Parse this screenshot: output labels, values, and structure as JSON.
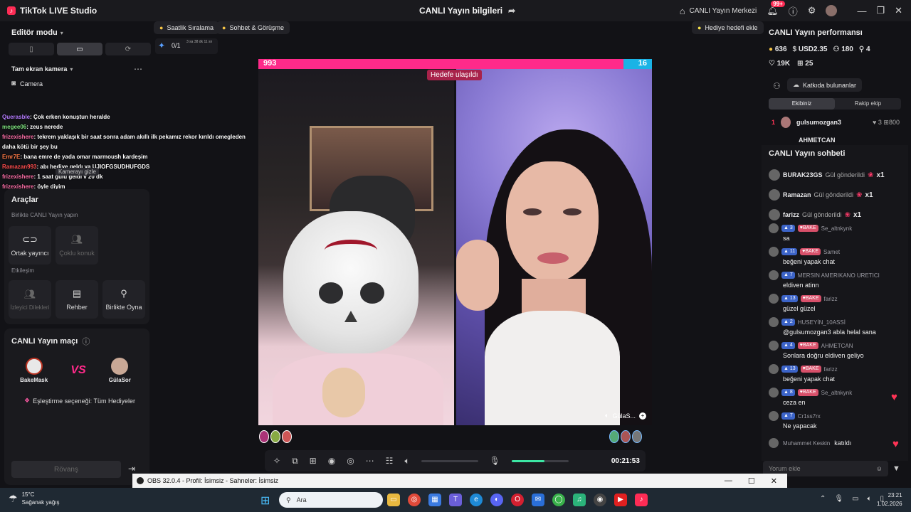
{
  "window": {
    "app_title": "TikTok LIVE Studio",
    "center_title": "CANLI Yayın bilgileri",
    "live_center": "CANLI Yayın Merkezi",
    "notif_count": "99+"
  },
  "left": {
    "editor_mode": "Editör modu",
    "camera_section": "Tam ekran kamera",
    "camera_source": "Camera",
    "overlay_chat": [
      {
        "user": "Querasble",
        "text": ": Çok erken konuştun heralde",
        "color": "#b57cff"
      },
      {
        "user": "megee06",
        "text": ": zeus nerede",
        "color": "#7ee37e"
      },
      {
        "user": "frizexishere",
        "text": ": tekrem yaklaşık bir saat sonra adam akıllı ilk pekamız rekor kırıldı omegleden daha kötü bir şey bu",
        "color": "#ff6fa8"
      },
      {
        "user": "Emr7E",
        "text": ": bana emre de yada omar marmoush kardeşim",
        "color": "#ff7a45"
      },
      {
        "user": "Ramazan993",
        "text": ": abı hediye geldı ya UJIOFGSUDHUFGDS",
        "color": "#ff4d4d"
      },
      {
        "user": "frizexishere",
        "text": ": 1 saat gülü geldı v 20 dk",
        "color": "#ff6fa8"
      },
      {
        "user": "frizexishere",
        "text": ": öyle diyim",
        "color": "#ff6fa8"
      }
    ],
    "tooltip": "Kamerayı gizle",
    "tools_title": "Araçlar",
    "together_title": "Birlikte CANLI Yayın yapın",
    "tile_cohost": "Ortak yayıncı",
    "tile_multiguest": "Çoklu konuk",
    "interaction_title": "Etkileşim",
    "tile_viewer_requests": "İzleyici Dilekleri",
    "tile_guide": "Rehber",
    "tile_play_together": "Birlikte Oyna",
    "match_title": "CANLI Yayın maçı",
    "host_a": "BakeMask",
    "host_b": "GülaSor",
    "match_vs": "VS",
    "match_option": "Eşleştirme seçeneği: Tüm Hediyeler",
    "rematch": "Rövanş"
  },
  "top_pills": {
    "hourly_rank": "Saatlik Sıralama",
    "chat_meet": "Sohbet & Görüşme",
    "gift_goal": "Hediye hedefi ekle",
    "goal_count": "0/1",
    "goal_time": "3 sa 38 dk 11 sn"
  },
  "battle": {
    "score_left": "993",
    "score_right": "16",
    "score_left_value": 993,
    "score_right_value": 16,
    "goal_reached": "Hedefe ulaşıldı",
    "guest_name": "GülaS..."
  },
  "controls": {
    "timer": "00:21:53",
    "mic_level": 0.58,
    "volume_level": 0.0
  },
  "right": {
    "perf_title": "CANLI Yayın performansı",
    "stat_coins": "636",
    "stat_usd": "USD2.35",
    "stat_viewers": "180",
    "stat_new": "4",
    "stat_likes": "19K",
    "stat_gifts": "25",
    "contributors": "Katkıda bulunanlar",
    "tab_team": "Ekibiniz",
    "tab_rival": "Rakip ekip",
    "rank1_num": "1",
    "rank1_name": "gulsumozgan3",
    "rank1_a": "3",
    "rank1_b": "800",
    "rank2_name": "AHMETCAN",
    "chat_title": "CANLI Yayın sohbeti",
    "gifts": [
      {
        "user": "BURAK23GS",
        "action": "Gül gönderildi",
        "count": "x1"
      },
      {
        "user": "Ramazan",
        "action": "Gül gönderildi",
        "count": "x1"
      },
      {
        "user": "farizz",
        "action": "Gül gönderildi",
        "count": "x1"
      }
    ],
    "messages": [
      {
        "level": "3",
        "fan": "BAKE",
        "user": "Se_altnkynk",
        "text": "sa"
      },
      {
        "level": "11",
        "fan": "BAKE",
        "user": "Samet",
        "text": "beğeni yapak chat"
      },
      {
        "level": "7",
        "fan": "",
        "user": "MERSIN AMERIKANO URETICI",
        "text": "eldiven atinn"
      },
      {
        "level": "13",
        "fan": "BAKE",
        "user": "farizz",
        "text": "güzel güzel"
      },
      {
        "level": "2",
        "fan": "",
        "user": "HUSEYİN_10ASSİ",
        "text": "@gulsumozgan3 abla helal sana"
      },
      {
        "level": "4",
        "fan": "BAKE",
        "user": "AHMETCAN",
        "text": "Sonlara doğru eldiven geliyo"
      },
      {
        "level": "13",
        "fan": "BAKE",
        "user": "farizz",
        "text": "beğeni yapak chat"
      },
      {
        "level": "8",
        "fan": "BAKE",
        "user": "Se_altnkynk",
        "text": "ceza en"
      },
      {
        "level": "7",
        "fan": "",
        "user": "Cr1ss7rx",
        "text": "Ne yapacak"
      }
    ],
    "joined_user": "Muhammet Keskin",
    "joined_text": "katıldı",
    "comment_placeholder": "Yorum ekle"
  },
  "obs": {
    "title": "OBS 32.0.4 - Profil: İsimsiz - Sahneler: İsimsiz"
  },
  "taskbar": {
    "temp": "15°C",
    "weather": "Sağanak yağış",
    "search": "Ara",
    "time": "23:21",
    "date": "1.02.2026"
  }
}
